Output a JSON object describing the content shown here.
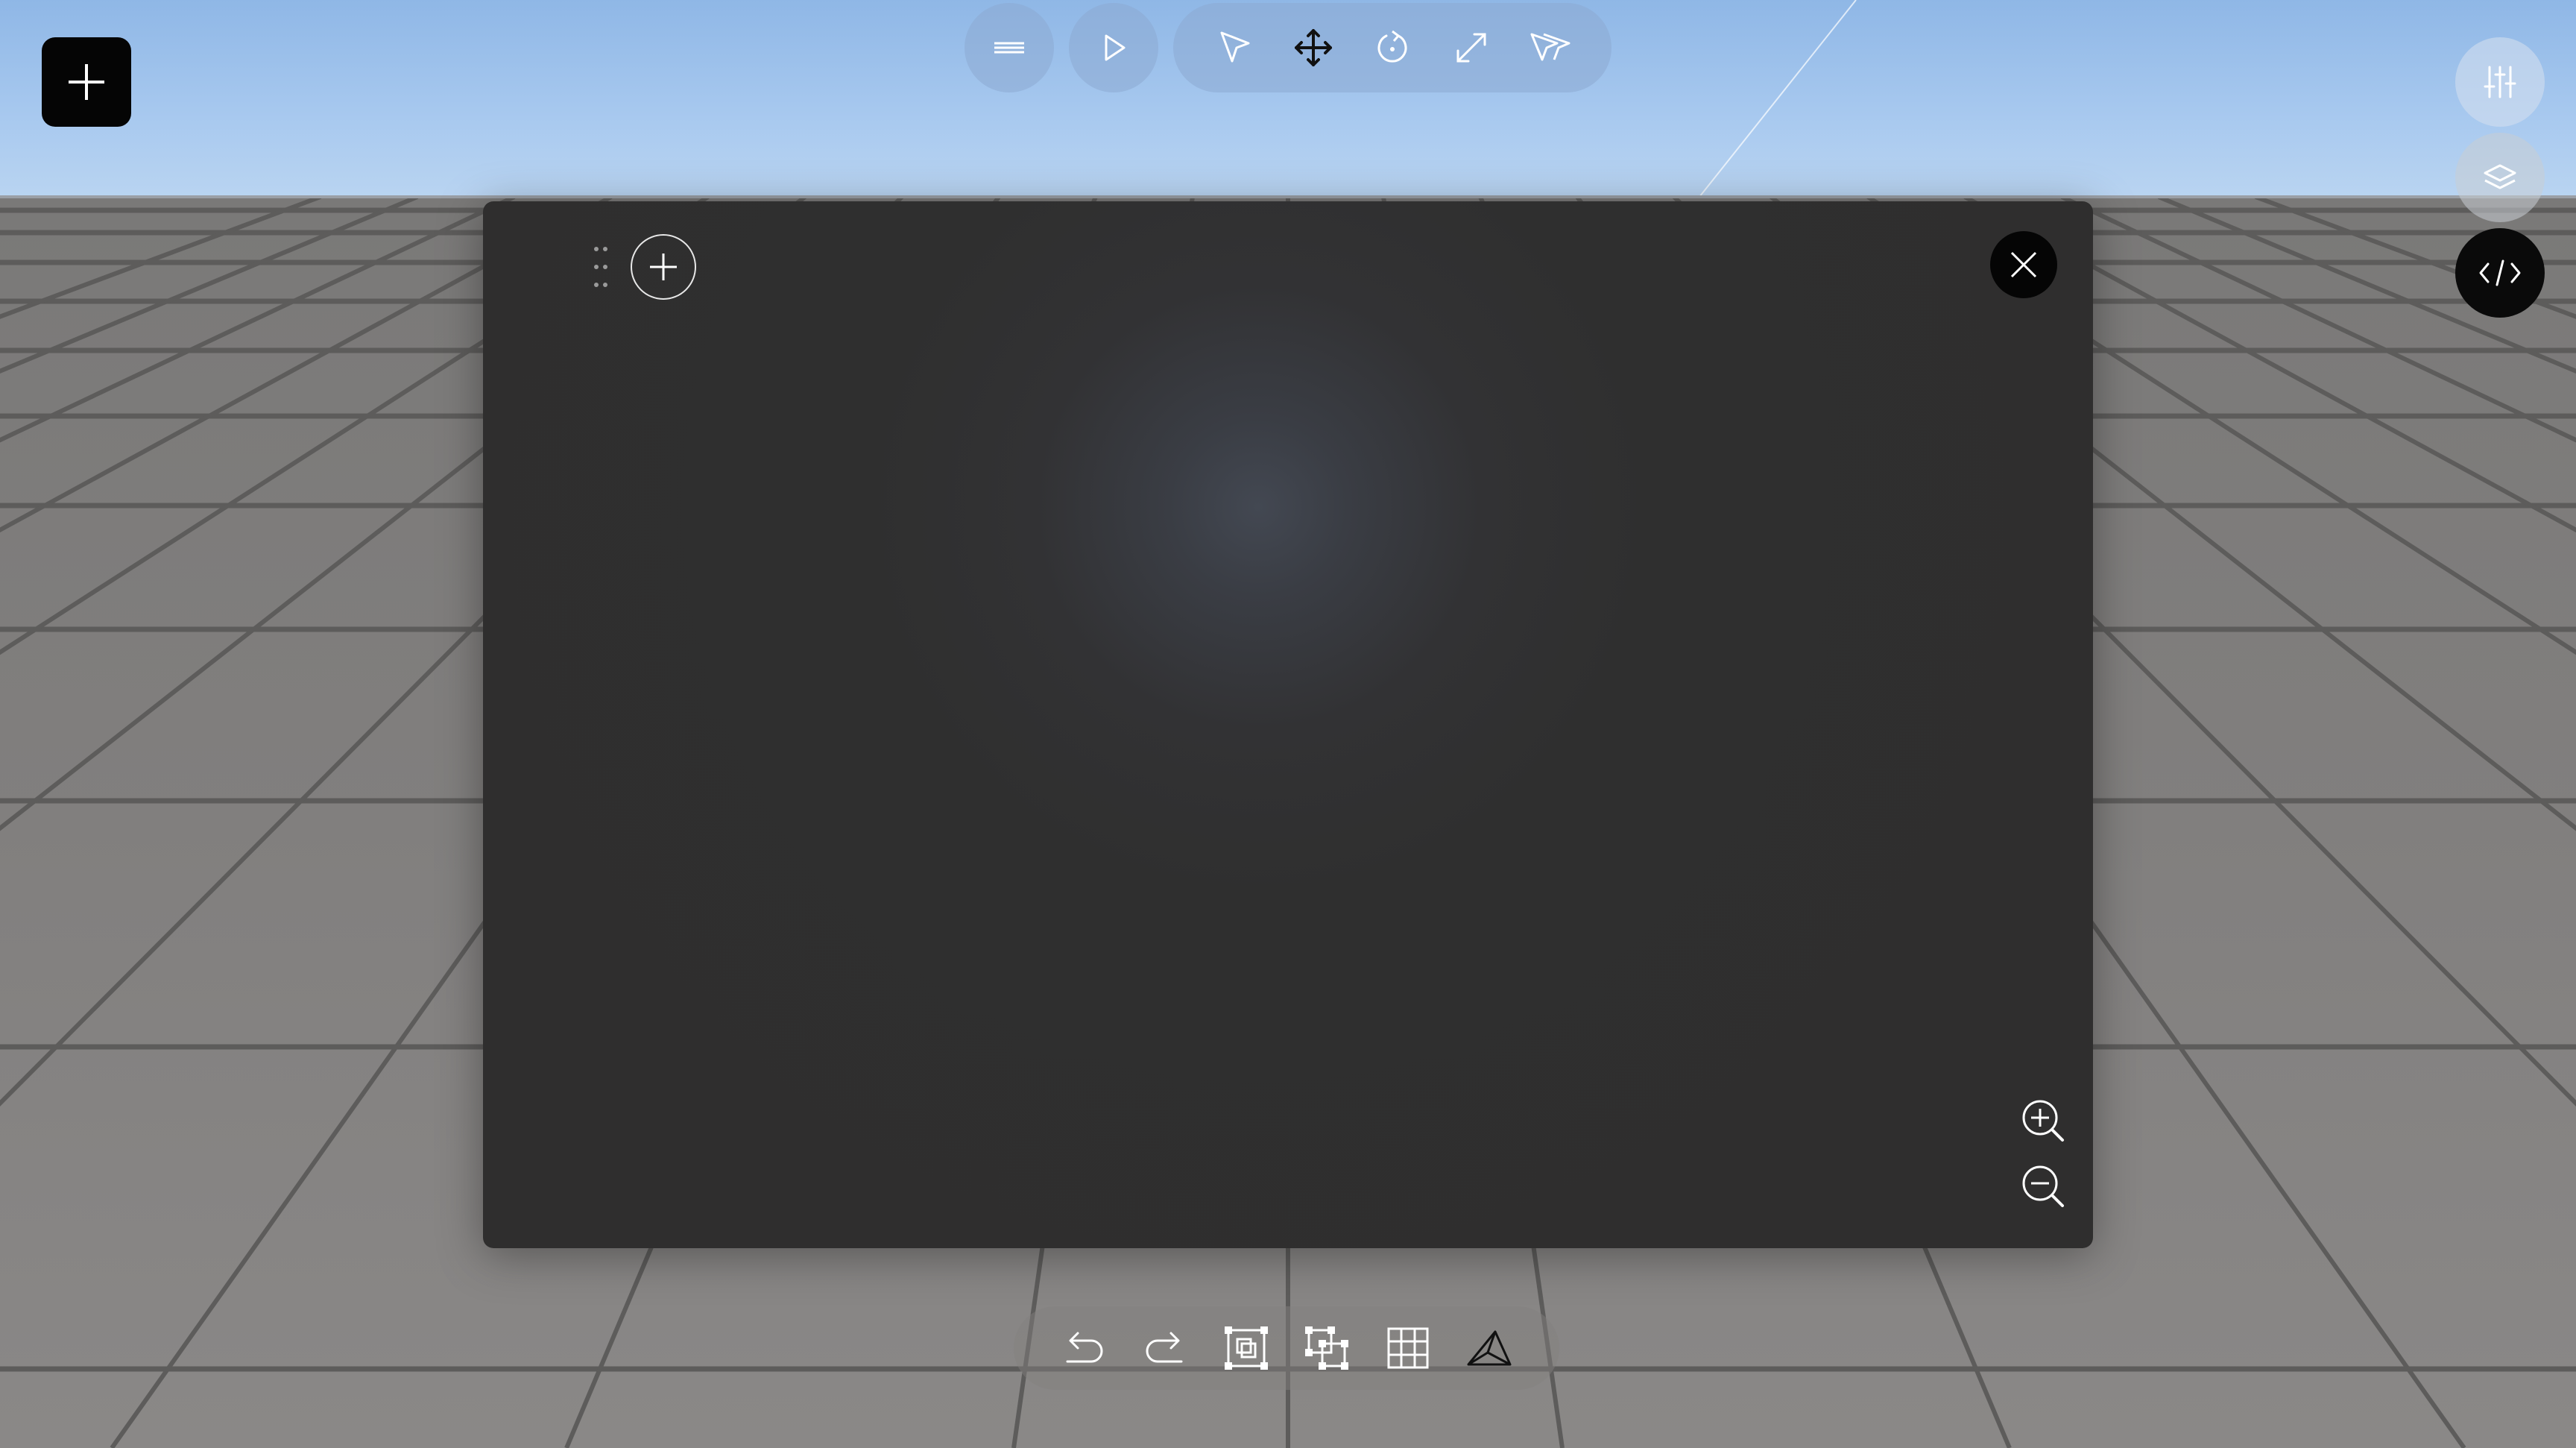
{
  "app": {
    "scene": "3d-editor-viewport"
  },
  "left_controls": {
    "add_icon": "plus-icon"
  },
  "top_toolbar": {
    "menu_icon": "menu-icon",
    "play_icon": "play-icon",
    "tools": [
      {
        "name": "select-tool",
        "icon": "cursor-arrow-icon",
        "active": false
      },
      {
        "name": "move-tool",
        "icon": "move-arrows-icon",
        "active": true
      },
      {
        "name": "rotate-tool",
        "icon": "rotate-icon",
        "active": false
      },
      {
        "name": "scale-tool",
        "icon": "expand-icon",
        "active": false
      },
      {
        "name": "multi-select-tool",
        "icon": "multi-cursor-icon",
        "active": false
      }
    ]
  },
  "right_controls": {
    "settings_icon": "sliders-icon",
    "layers_icon": "layers-icon",
    "code_icon": "code-icon"
  },
  "editor_panel": {
    "add_icon": "plus-circle-icon",
    "close_icon": "close-icon",
    "zoom_in_icon": "zoom-in-icon",
    "zoom_out_icon": "zoom-out-icon"
  },
  "bottom_toolbar": {
    "items": [
      {
        "name": "undo",
        "icon": "undo-icon"
      },
      {
        "name": "redo",
        "icon": "redo-icon"
      },
      {
        "name": "group",
        "icon": "group-icon"
      },
      {
        "name": "ungroup",
        "icon": "ungroup-icon"
      },
      {
        "name": "grid",
        "icon": "grid-icon"
      },
      {
        "name": "camera",
        "icon": "camera-view-icon"
      }
    ]
  },
  "colors": {
    "sky_top": "#8fb7e6",
    "ground": "#7d7b7a",
    "panel_bg": "#2f2e2e",
    "accent_dark": "#050505"
  }
}
